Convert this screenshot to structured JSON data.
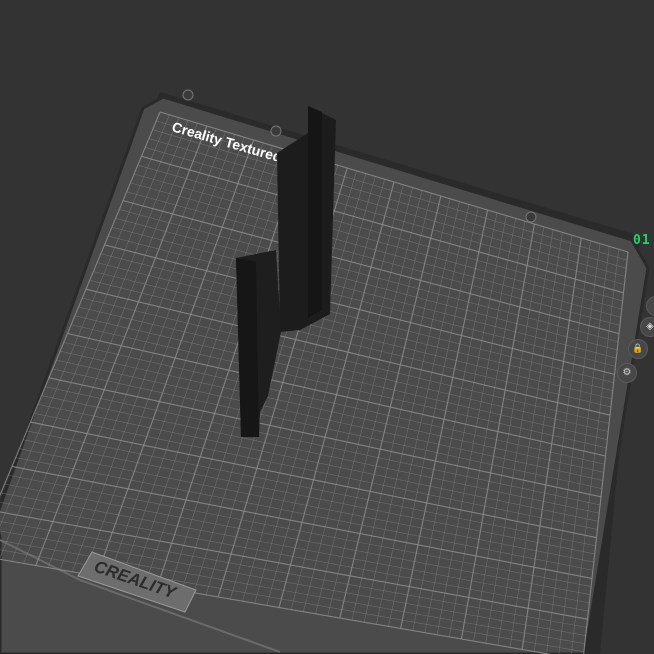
{
  "scene": {
    "background": "#333333",
    "bed": {
      "plate_title": "Creality Textured Plate",
      "brand_logo": "CREALITY",
      "plate_color": "#4b4b4b",
      "grid_color": "#8a8a8a",
      "rim_color": "#262626"
    },
    "model": {
      "color": "#1c1c1c"
    }
  },
  "overlay": {
    "coordinate_text": "01",
    "accent_color": "#1fd36a"
  },
  "toolbar_icons": [
    {
      "name": "partial-tool-icon",
      "glyph": "◦"
    },
    {
      "name": "layer-tool-icon",
      "glyph": "◈"
    },
    {
      "name": "lock-icon",
      "glyph": "🔒"
    },
    {
      "name": "settings-gear-icon",
      "glyph": "⚙"
    }
  ]
}
